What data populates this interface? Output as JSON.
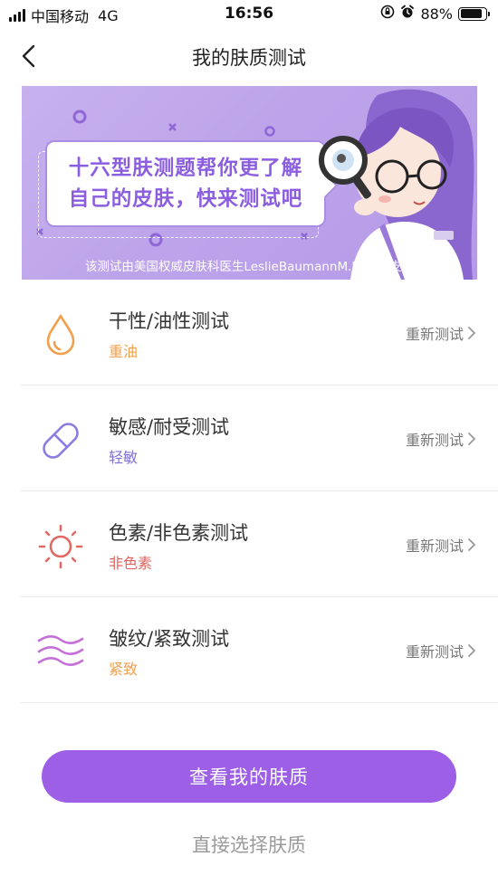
{
  "status_bar": {
    "carrier": "中国移动",
    "network": "4G",
    "time": "16:56",
    "battery": "88%",
    "battery_level": 0.88
  },
  "nav": {
    "title": "我的肤质测试",
    "back_icon": "chevron-left-icon"
  },
  "banner": {
    "headline": "十六型肤测题帮你更了解\n自己的皮肤，快来测试吧",
    "caption": "该测试由美国权威皮肤科医生LeslieBaumannM.D 提供支持",
    "colors": {
      "background": "#bda4ea",
      "text": "#8b5ee0"
    }
  },
  "tests": [
    {
      "title": "干性/油性测试",
      "result": "重油",
      "result_color": "#f0a04b",
      "icon": "droplet-icon",
      "icon_color": "#f0a04b",
      "action": "重新测试"
    },
    {
      "title": "敏感/耐受测试",
      "result": "轻敏",
      "result_color": "#7e70d8",
      "icon": "capsule-icon",
      "icon_color": "#8c7ee0",
      "action": "重新测试"
    },
    {
      "title": "色素/非色素测试",
      "result": "非色素",
      "result_color": "#e0635d",
      "icon": "sun-icon",
      "icon_color": "#e06a63",
      "action": "重新测试"
    },
    {
      "title": "皱纹/紧致测试",
      "result": "紧致",
      "result_color": "#f0a04b",
      "icon": "waves-icon",
      "icon_color": "#c470d8",
      "action": "重新测试"
    }
  ],
  "primary_button": {
    "label": "查看我的肤质",
    "color": "#9c5fe6"
  },
  "secondary_link": {
    "label": "直接选择肤质"
  }
}
